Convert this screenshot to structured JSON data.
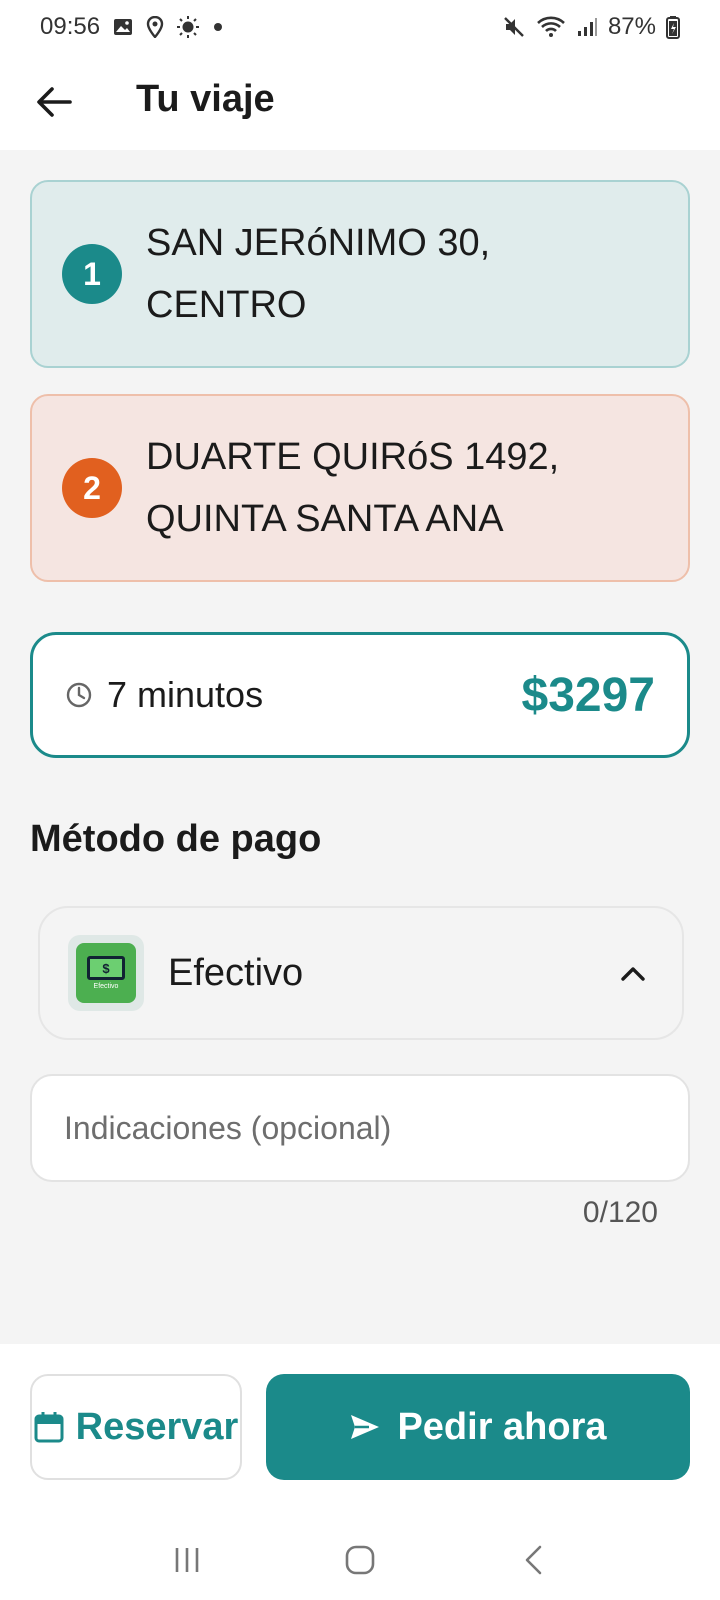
{
  "status_bar": {
    "time": "09:56",
    "battery": "87%",
    "icons": [
      "image-icon",
      "location-icon",
      "brightness-icon",
      "dot-icon",
      "mute-icon",
      "wifi-icon",
      "signal-icon",
      "battery-icon"
    ]
  },
  "header": {
    "title": "Tu viaje",
    "back_icon": "arrow-left-icon"
  },
  "stops": [
    {
      "number": "1",
      "line1": "SAN JERóNIMO 30,",
      "line2": "CENTRO",
      "color": "#1b8a8a"
    },
    {
      "number": "2",
      "line1": "DUARTE QUIRóS 1492,",
      "line2": "QUINTA SANTA ANA",
      "color": "#e1601f"
    }
  ],
  "trip": {
    "duration": "7 minutos",
    "price": "$3297",
    "clock_icon": "clock-icon"
  },
  "payment": {
    "section_title": "Método de pago",
    "method": "Efectivo",
    "icon_caption": "Efectivo",
    "icon": "cash-icon",
    "chevron": "chevron-up-icon"
  },
  "notes": {
    "placeholder": "Indicaciones (opcional)",
    "value": "",
    "counter": "0/120"
  },
  "actions": {
    "reserve_label": "Reservar",
    "request_label": "Pedir ahora",
    "accent": "#1b8a8a"
  },
  "system_nav": [
    "recents-icon",
    "home-icon",
    "back-icon"
  ]
}
